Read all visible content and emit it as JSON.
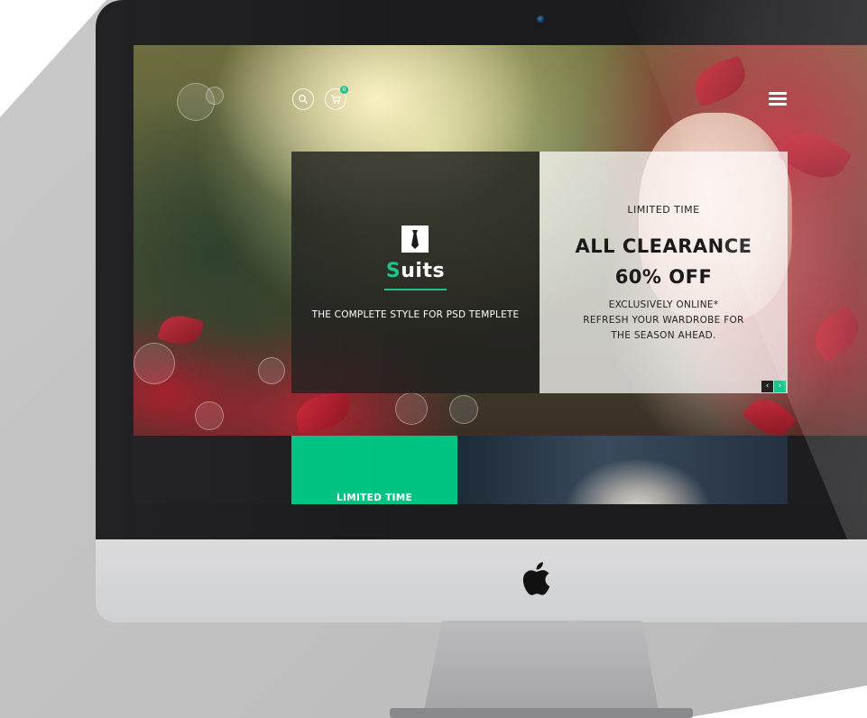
{
  "header": {
    "search_icon": "search-icon",
    "cart_icon": "cart-icon",
    "cart_count": "0",
    "menu_icon": "hamburger-menu-icon"
  },
  "slider": {
    "brand_first_letter": "S",
    "brand_rest": "uits",
    "tagline": "THE COMPLETE STYLE FOR PSD TEMPLETE",
    "promo_kicker": "LIMITED TIME",
    "headline_line1": "ALL CLEARANCE",
    "headline_line2": "60% OFF",
    "desc_line1": "EXCLUSIVELY ONLINE*",
    "desc_line2": "REFRESH YOUR WARDROBE FOR",
    "desc_line3": "THE SEASON AHEAD.",
    "prev_arrow": "‹",
    "next_arrow": "›"
  },
  "lower": {
    "promo_label": "LIMITED TIME"
  },
  "colors": {
    "accent": "#1ec38b",
    "promo_green": "#00c381",
    "bezel": "#1b1b1d"
  }
}
